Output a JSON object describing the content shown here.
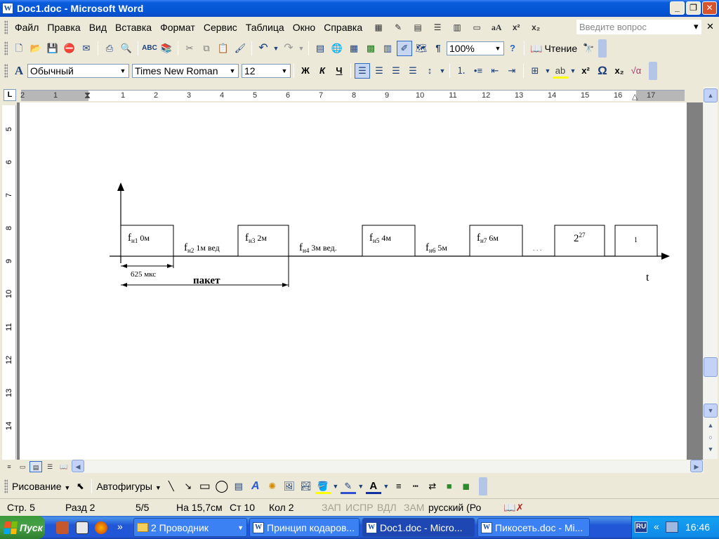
{
  "window": {
    "title": "Doc1.doc - Microsoft Word",
    "icon": "word-doc-icon"
  },
  "menu": {
    "items": [
      "Файл",
      "Правка",
      "Вид",
      "Вставка",
      "Формат",
      "Сервис",
      "Таблица",
      "Окно",
      "Справка"
    ],
    "help_placeholder": "Введите вопрос"
  },
  "standard_toolbar": {
    "zoom": "100%",
    "read_label": "Чтение"
  },
  "format_toolbar": {
    "style": "Обычный",
    "font": "Times New Roman",
    "size": "12"
  },
  "ruler": {
    "h_labels": [
      "2",
      "1",
      "1",
      "2",
      "3",
      "4",
      "5",
      "6",
      "7",
      "8",
      "9",
      "10",
      "11",
      "12",
      "13",
      "14",
      "15",
      "16",
      "17"
    ],
    "v_labels": [
      "5",
      "6",
      "7",
      "8",
      "9",
      "10",
      "11",
      "12",
      "13",
      "14"
    ],
    "corner": "L"
  },
  "diagram": {
    "slots": [
      {
        "kind": "box",
        "f_sub": "н1",
        "text": "0м"
      },
      {
        "kind": "gap",
        "f_sub": "н2",
        "text": "1м  вед"
      },
      {
        "kind": "box",
        "f_sub": "н3",
        "text": "2м"
      },
      {
        "kind": "gap",
        "f_sub": "н4",
        "text": "3м вед."
      },
      {
        "kind": "box",
        "f_sub": "н5",
        "text": "4м"
      },
      {
        "kind": "gap",
        "f_sub": "н6",
        "text": "5м"
      },
      {
        "kind": "box",
        "f_sub": "н7",
        "text": "6м"
      }
    ],
    "f_letter": "f",
    "ellipsis": ". . .",
    "power_base": "2",
    "power_exp": "27",
    "last_box": "1",
    "slot_duration": "625 мкс",
    "packet_label": "пакет",
    "axis_label": "t"
  },
  "drawing_toolbar": {
    "draw_label": "Рисование",
    "autoshapes_label": "Автофигуры"
  },
  "status": {
    "page": "Стр. 5",
    "section": "Разд  2",
    "pages": "5/5",
    "at": "На 15,7см",
    "line": "Ст  10",
    "col": "Кол  2",
    "rec": "ЗАП",
    "trk": "ИСПР",
    "ext": "ВДЛ",
    "ovr": "ЗАМ",
    "lang": "русский (Ро"
  },
  "taskbar": {
    "start": "Пуск",
    "more": "»",
    "tasks": [
      {
        "label": "2 Проводник",
        "type": "folder",
        "dropdown": "▼"
      },
      {
        "label": "Принцип кодаров...",
        "type": "word"
      },
      {
        "label": "Doc1.doc - Micro...",
        "type": "word",
        "active": true
      },
      {
        "label": "Пикосеть.doc - Mi...",
        "type": "word"
      }
    ],
    "lang": "RU",
    "tray_arrow": "«",
    "clock": "16:46"
  }
}
